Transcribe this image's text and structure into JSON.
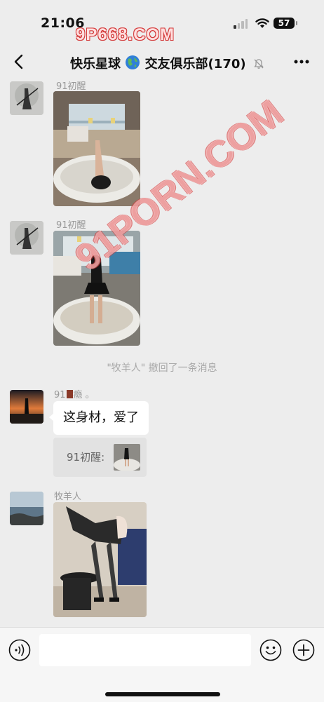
{
  "status_bar": {
    "time": "21:06",
    "battery": "57",
    "watermark": "9P668.COM"
  },
  "overlay": {
    "watermark": "91PORN.COM"
  },
  "header": {
    "title": "快乐星球",
    "title_suffix": "交友俱乐部(170)",
    "icons": [
      "back-arrow-icon",
      "globe-emoji-icon",
      "mute-bell-icon",
      "more-dots-icon"
    ]
  },
  "messages": [
    {
      "sender": "91初醒",
      "type": "image"
    },
    {
      "sender": "91初醒",
      "type": "image"
    },
    {
      "type": "system",
      "text": "\"牧羊人\" 撤回了一条消息"
    },
    {
      "sender": "91",
      "sender_suffix": "瘾 。",
      "type": "text",
      "text": "这身材，爱了",
      "quote": "91初醒:"
    },
    {
      "sender": "牧羊人",
      "type": "image"
    }
  ],
  "input_bar": {
    "placeholder": "",
    "icons": [
      "voice-icon",
      "emoji-icon",
      "plus-icon"
    ]
  },
  "colors": {
    "background": "#ededed",
    "bubble": "#ffffff",
    "input_bar": "#f6f6f6",
    "watermark": "#d43a3a"
  }
}
